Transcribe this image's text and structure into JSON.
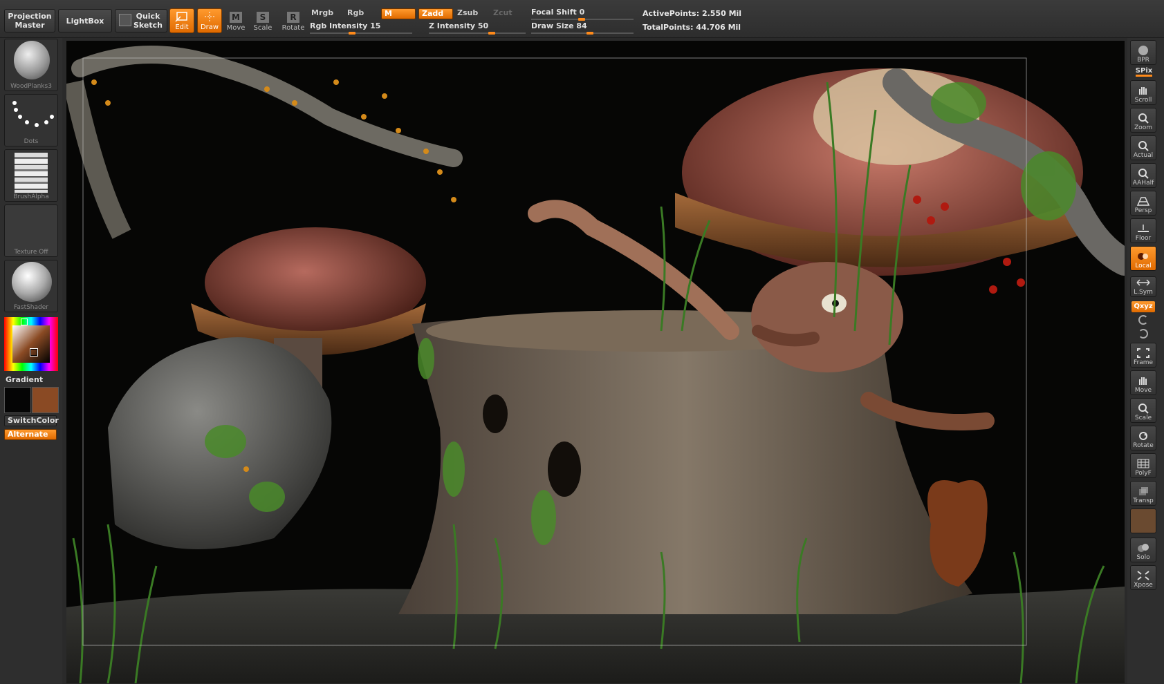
{
  "topbar": {
    "projection_master": "Projection\nMaster",
    "lightbox": "LightBox",
    "quick_sketch": "Quick\nSketch",
    "tools": {
      "edit": "Edit",
      "draw": "Draw",
      "move": "Move",
      "scale": "Scale",
      "rotate": "Rotate"
    },
    "tool_letters": {
      "move": "M",
      "scale": "S",
      "rotate": "R"
    },
    "mrgb": "Mrgb",
    "rgb": "Rgb",
    "m": "M",
    "zadd": "Zadd",
    "zsub": "Zsub",
    "zcut": "Zcut",
    "rgb_intensity_label": "Rgb Intensity",
    "rgb_intensity_value": "15",
    "z_intensity_label": "Z Intensity",
    "z_intensity_value": "50",
    "focal_shift_label": "Focal Shift",
    "focal_shift_value": "0",
    "draw_size_label": "Draw Size",
    "draw_size_value": "84",
    "active_points": "ActivePoints: 2.550 Mil",
    "total_points": "TotalPoints: 44.706 Mil"
  },
  "left_shelf": {
    "material": "WoodPlanks3",
    "stroke": "Dots",
    "alpha": "BrushAlpha",
    "texture": "Texture Off",
    "shader": "FastShader",
    "gradient": "Gradient",
    "switch_color": "SwitchColor",
    "alternate": "Alternate",
    "colors": {
      "main": "#050505",
      "secondary": "#8a4a24",
      "accent": "#ff8a1a"
    }
  },
  "right_bar": {
    "bpr": "BPR",
    "spix": "SPix",
    "scroll": "Scroll",
    "zoom": "Zoom",
    "actual": "Actual",
    "aahalf": "AAHalf",
    "persp": "Persp",
    "floor": "Floor",
    "local": "Local",
    "lsym": "L.Sym",
    "xyz": "Qxyz",
    "frame": "Frame",
    "move": "Move",
    "scale": "Scale",
    "rotate": "Rotate",
    "polyf": "PolyF",
    "transp": "Transp",
    "solo": "Solo",
    "xpose": "Xpose"
  }
}
